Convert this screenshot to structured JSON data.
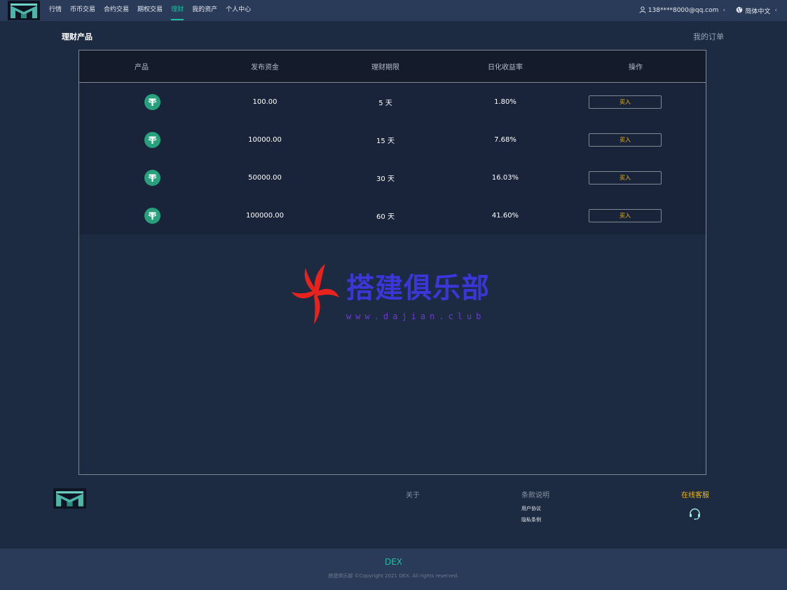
{
  "colors": {
    "accent": "#1fbfa0",
    "buy": "#f0b90b",
    "topbar": "#2a3b5a",
    "page_bg": "#1c2a42",
    "usdt": "#26a17b"
  },
  "nav": {
    "logo_icon": "brand-logo",
    "items": [
      {
        "label": "行情",
        "active": false
      },
      {
        "label": "币币交易",
        "active": false
      },
      {
        "label": "合约交易",
        "active": false
      },
      {
        "label": "期权交易",
        "active": false
      },
      {
        "label": "理财",
        "active": true
      },
      {
        "label": "我的资产",
        "active": false
      },
      {
        "label": "个人中心",
        "active": false
      }
    ],
    "user_email": "138****8000@qq.com",
    "language": "简体中文"
  },
  "page": {
    "title": "理财产品",
    "my_orders": "我的订单"
  },
  "table": {
    "headers": [
      "产品",
      "发布资金",
      "理财期限",
      "日化收益率",
      "操作"
    ],
    "rows": [
      {
        "icon": "usdt-coin-icon",
        "amount": "100.00",
        "term": "5 天",
        "rate": "1.80%",
        "action": "买入"
      },
      {
        "icon": "usdt-coin-icon",
        "amount": "10000.00",
        "term": "15 天",
        "rate": "7.68%",
        "action": "买入"
      },
      {
        "icon": "usdt-coin-icon",
        "amount": "50000.00",
        "term": "30 天",
        "rate": "16.03%",
        "action": "买入"
      },
      {
        "icon": "usdt-coin-icon",
        "amount": "100000.00",
        "term": "60 天",
        "rate": "41.60%",
        "action": "买入"
      }
    ]
  },
  "watermark": {
    "text": "搭建俱乐部",
    "url": "www.dajian.club"
  },
  "footer": {
    "about": "关于",
    "terms_heading": "条款说明",
    "terms_links": [
      "用户协议",
      "隐私条例"
    ],
    "service": "在线客服",
    "brand": "DEX",
    "copyright": "搭建俱乐部 ©Copyright 2021 DEX. All rights reserved."
  }
}
